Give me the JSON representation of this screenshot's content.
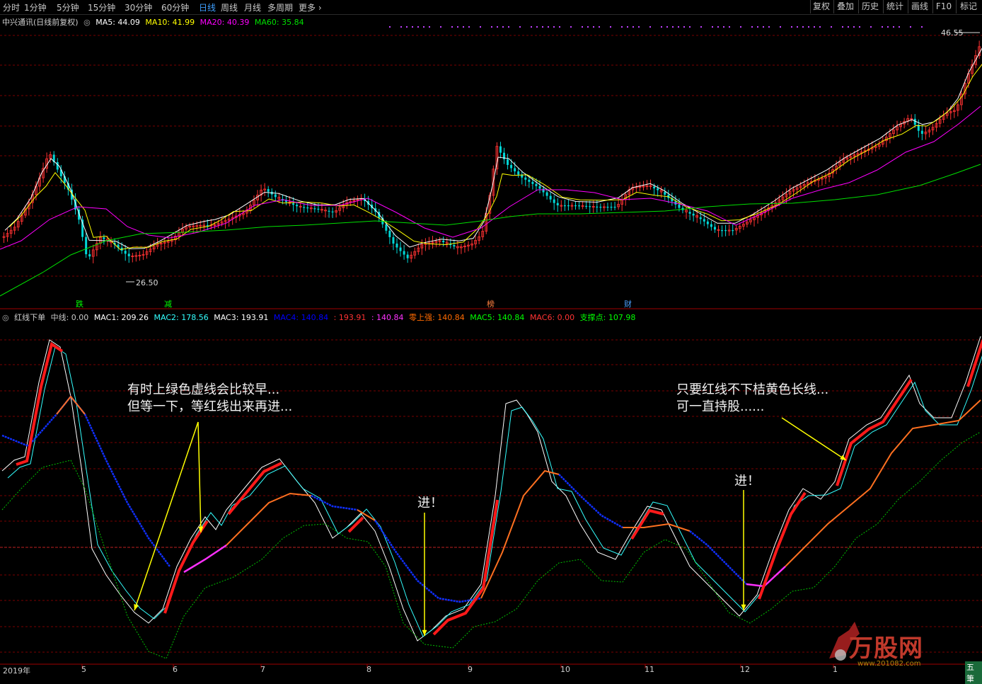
{
  "toolbar": {
    "periods": [
      "分时",
      "1分钟",
      "5分钟",
      "15分钟",
      "30分钟",
      "60分钟",
      "日线",
      "周线",
      "月线",
      "多周期",
      "更多"
    ],
    "active_period": "日线",
    "right_buttons": [
      "复权",
      "叠加",
      "历史",
      "统计",
      "画线",
      "F10",
      "标记"
    ]
  },
  "main_panel": {
    "title": "中兴通讯(日线前复权)",
    "ma": [
      {
        "label": "MA5: 44.09",
        "color": "#ffffff"
      },
      {
        "label": "MA10: 41.99",
        "color": "#ffff00"
      },
      {
        "label": "MA20: 40.39",
        "color": "#ff00ff"
      },
      {
        "label": "MA60: 35.84",
        "color": "#00e000"
      }
    ],
    "high_label": "46.55",
    "low_label": "26.50",
    "signals": [
      {
        "text": "跌",
        "color": "#00ff00"
      },
      {
        "text": "减",
        "color": "#00ff00"
      },
      {
        "text": "榜",
        "color": "#ff8040"
      },
      {
        "text": "财",
        "color": "#4aa0ff"
      }
    ]
  },
  "indicator_panel": {
    "name": "红线下单",
    "items": [
      {
        "label": "中线: 0.00",
        "color": "#c8c8c8"
      },
      {
        "label": "MAC1: 209.26",
        "color": "#ffffff"
      },
      {
        "label": "MAC2: 178.56",
        "color": "#33ffff"
      },
      {
        "label": "MAC3: 193.91",
        "color": "#ffffff"
      },
      {
        "label": "MAC4: 140.84",
        "color": "#0000ff"
      },
      {
        "label": ": 193.91",
        "color": "#ff3333"
      },
      {
        "label": ": 140.84",
        "color": "#ff33ff"
      },
      {
        "label": "零上强: 140.84",
        "color": "#ff6a00"
      },
      {
        "label": "MAC5: 140.84",
        "color": "#00ff00"
      },
      {
        "label": "MAC6: 0.00",
        "color": "#ff3333"
      },
      {
        "label": "支撑点: 107.98",
        "color": "#00ff00"
      }
    ]
  },
  "annotations": {
    "note1_line1": "有时上绿色虚线会比较早...",
    "note1_line2": "但等一下，等红线出来再进...",
    "note2": "进！",
    "note3": "进！",
    "note4_line1": "只要红线不下桔黄色长线...",
    "note4_line2": "可一直持股......"
  },
  "x_axis": [
    "2019年",
    "5",
    "6",
    "7",
    "8",
    "9",
    "10",
    "11",
    "12",
    "1"
  ],
  "watermark": {
    "brand": "万股网",
    "url": "www.201082.com",
    "corner": "五筆"
  },
  "colors": {
    "up": "#ff3232",
    "down": "#00d7d7",
    "grid": "#7a0000"
  },
  "chart_data": [
    {
      "type": "candlestick",
      "title": "中兴通讯(日线前复权)",
      "series": [
        {
          "name": "MA5",
          "values": [
            44.09
          ]
        },
        {
          "name": "MA10",
          "values": [
            41.99
          ]
        },
        {
          "name": "MA20",
          "values": [
            40.39
          ]
        },
        {
          "name": "MA60",
          "values": [
            35.84
          ]
        }
      ],
      "annotations": [
        "46.55",
        "26.50"
      ]
    },
    {
      "type": "line",
      "title": "红线下单",
      "series": [
        {
          "name": "MAC1",
          "values": [
            209.26
          ]
        },
        {
          "name": "MAC2",
          "values": [
            178.56
          ]
        },
        {
          "name": "MAC3",
          "values": [
            193.91
          ]
        },
        {
          "name": "MAC4",
          "values": [
            140.84
          ]
        },
        {
          "name": "零上强",
          "values": [
            140.84
          ]
        },
        {
          "name": "MAC5",
          "values": [
            140.84
          ]
        },
        {
          "name": "MAC6",
          "values": [
            0.0
          ]
        },
        {
          "name": "支撑点",
          "values": [
            107.98
          ]
        }
      ]
    }
  ]
}
